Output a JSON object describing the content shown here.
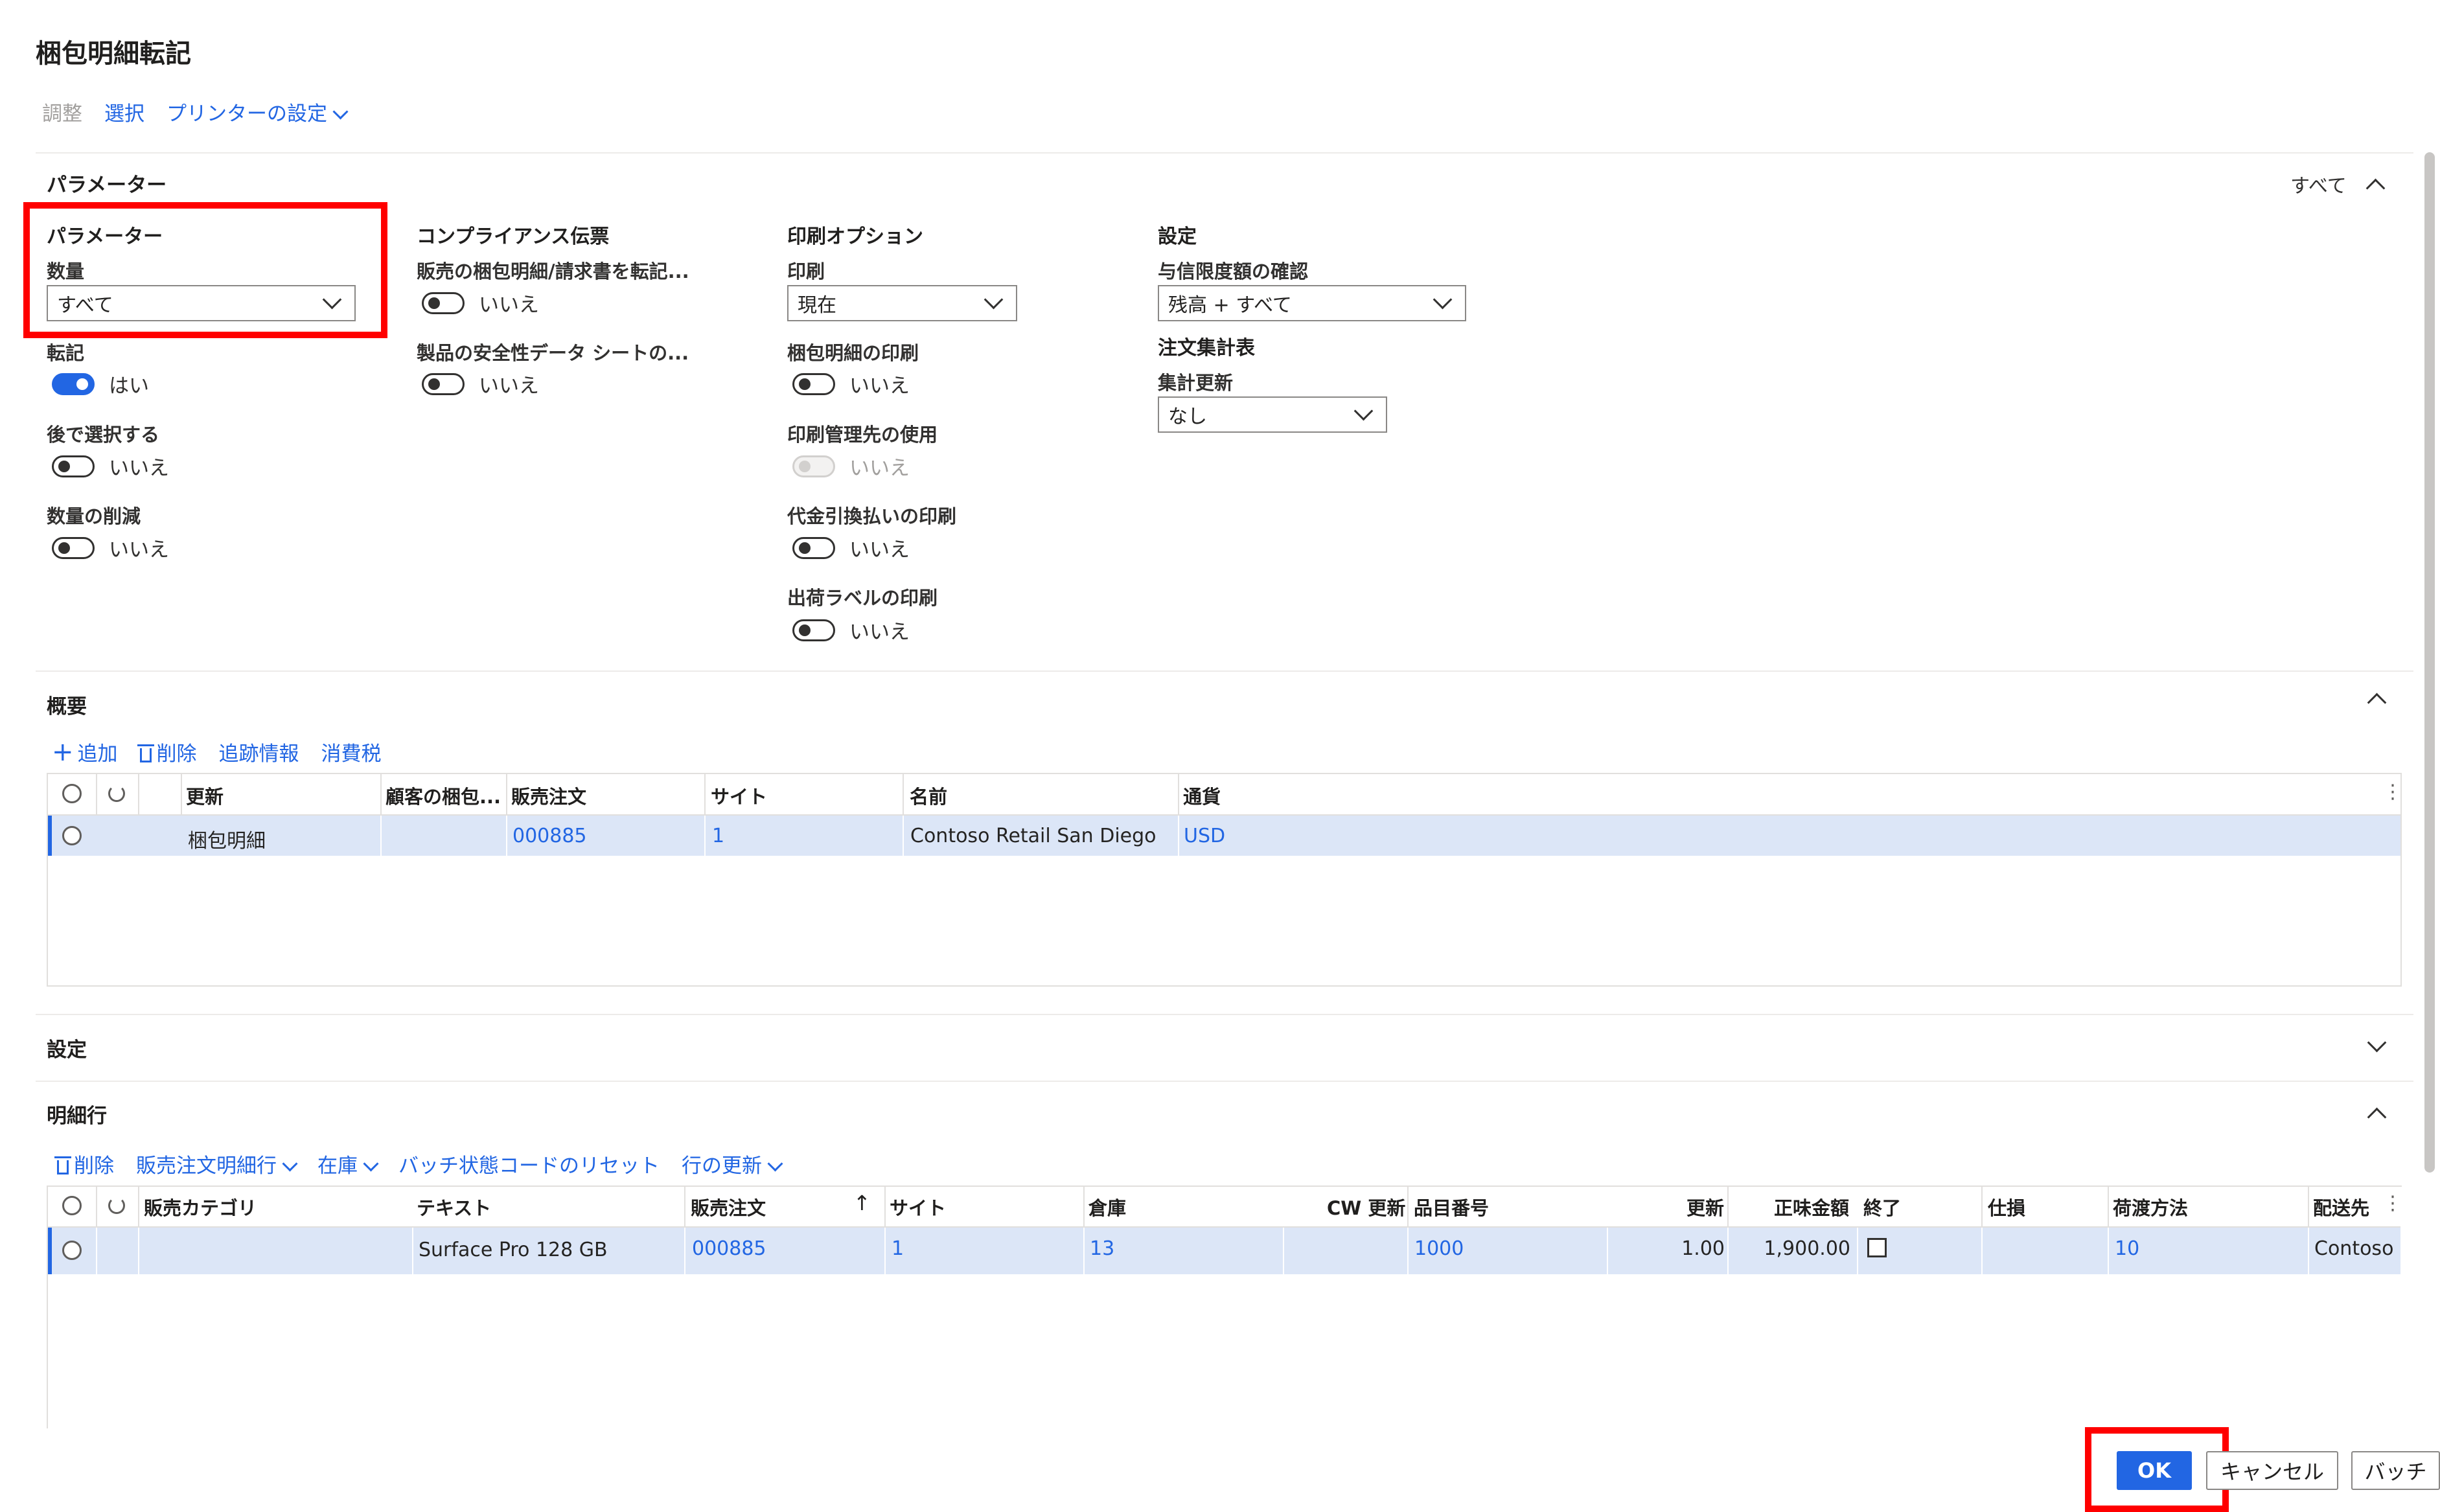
{
  "dialog": {
    "title": "梱包明細転記",
    "top_actions": {
      "adjust": "調整",
      "select": "選択",
      "printer_setup": "プリンターの設定"
    }
  },
  "params_section": {
    "title": "パラメーター",
    "toggle_all": "すべて",
    "parameters_group": {
      "title": "パラメーター",
      "quantity_label": "数量",
      "quantity_value": "すべて",
      "post_label": "転記",
      "post_value": "はい",
      "select_later_label": "後で選択する",
      "select_later_value": "いいえ",
      "reduce_qty_label": "数量の削減",
      "reduce_qty_value": "いいえ"
    },
    "compliance_group": {
      "title": "コンプライアンス伝票",
      "post_invoice_label": "販売の梱包明細/請求書を転記...",
      "post_invoice_value": "いいえ",
      "safety_sheet_label": "製品の安全性データ シートの...",
      "safety_sheet_value": "いいえ"
    },
    "print_group": {
      "title": "印刷オプション",
      "print_label": "印刷",
      "print_value": "現在",
      "print_slip_label": "梱包明細の印刷",
      "print_slip_value": "いいえ",
      "print_mgmt_label": "印刷管理先の使用",
      "print_mgmt_value": "いいえ",
      "cod_label": "代金引換払いの印刷",
      "cod_value": "いいえ",
      "ship_label_label": "出荷ラベルの印刷",
      "ship_label_value": "いいえ"
    },
    "settings_group": {
      "title": "設定",
      "credit_check_label": "与信限度額の確認",
      "credit_check_value": "残高 + すべて",
      "summary_title": "注文集計表",
      "summary_update_label": "集計更新",
      "summary_update_value": "なし"
    }
  },
  "overview": {
    "title": "概要",
    "actions": {
      "add": "追加",
      "delete": "削除",
      "tracking": "追跡情報",
      "tax": "消費税"
    },
    "columns": [
      "更新",
      "顧客の梱包...",
      "販売注文",
      "サイト",
      "名前",
      "通貨"
    ],
    "rows": [
      {
        "update": "梱包明細",
        "customer_slip": "",
        "sales_order": "000885",
        "site": "1",
        "name": "Contoso Retail San Diego",
        "currency": "USD"
      }
    ]
  },
  "settings_section": {
    "title": "設定"
  },
  "lines": {
    "title": "明細行",
    "actions": {
      "delete": "削除",
      "sales_line": "販売注文明細行",
      "inventory": "在庫",
      "reset_batch": "バッチ状態コードのリセット",
      "update_line": "行の更新"
    },
    "columns": [
      "販売カテゴリ",
      "テキスト",
      "販売注文",
      "サイト",
      "倉庫",
      "CW 更新",
      "品目番号",
      "更新",
      "正味金額",
      "終了",
      "仕損",
      "荷渡方法",
      "配送先"
    ],
    "sort_indicator": "↑",
    "rows": [
      {
        "category": "",
        "text": "Surface Pro 128 GB",
        "sales_order": "000885",
        "site": "1",
        "warehouse": "13",
        "cw_update": "",
        "item_number": "1000",
        "update": "1.00",
        "net_amount": "1,900.00",
        "closed": false,
        "scrap": "",
        "delivery_mode": "10",
        "ship_to": "Contoso"
      }
    ]
  },
  "footer": {
    "ok": "OK",
    "cancel": "キャンセル",
    "batch": "バッチ"
  },
  "colors": {
    "accent": "#2266e3",
    "highlight": "#ff0000",
    "selected_row": "#dce6f7"
  }
}
